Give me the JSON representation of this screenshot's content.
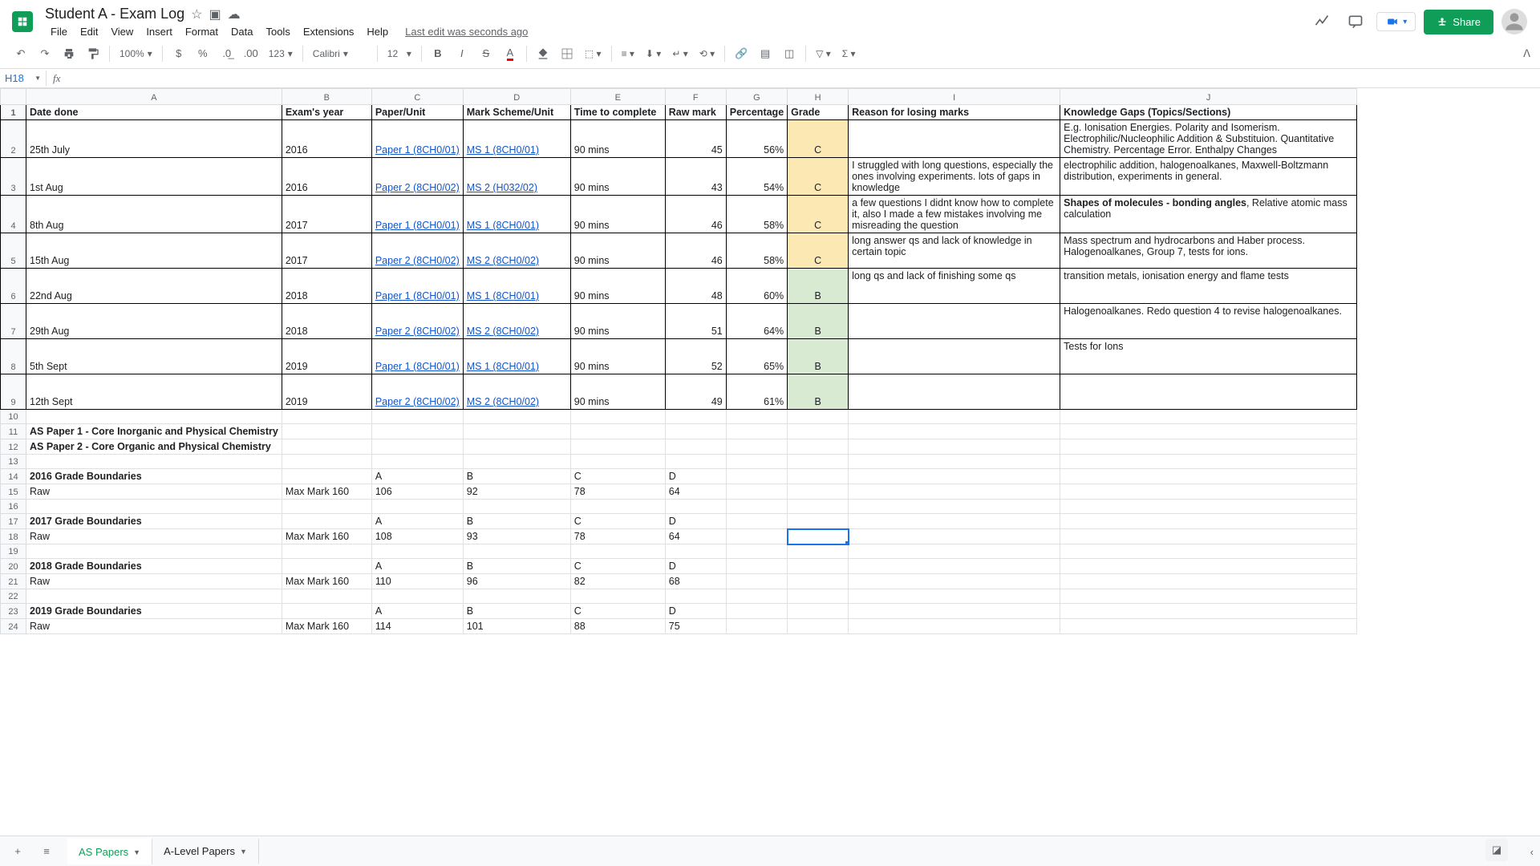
{
  "header": {
    "doc_title": "Student A - Exam Log",
    "menus": [
      "File",
      "Edit",
      "View",
      "Insert",
      "Format",
      "Data",
      "Tools",
      "Extensions",
      "Help"
    ],
    "last_edit": "Last edit was seconds ago",
    "share_label": "Share"
  },
  "toolbar": {
    "zoom": "100%",
    "dec_format": "123",
    "font": "Calibri",
    "size": "12"
  },
  "namebox": {
    "cell": "H18"
  },
  "columns": [
    "A",
    "B",
    "C",
    "D",
    "E",
    "F",
    "G",
    "H",
    "I",
    "J"
  ],
  "headers": [
    "Date done",
    "Exam's year",
    "Paper/Unit",
    "Mark Scheme/Unit",
    "Time to complete",
    "Raw mark",
    "Percentage",
    "Grade",
    "Reason for losing marks",
    "Knowledge Gaps (Topics/Sections)"
  ],
  "rows": [
    {
      "date": "25th July",
      "year": "2016",
      "paper": "Paper 1 (8CH0/01)",
      "ms": "MS 1 (8CH0/01)",
      "time": "90 mins",
      "raw": "45",
      "pct": "56%",
      "grade": "C",
      "gc": "grade-c",
      "reason": "",
      "gaps": "E.g. Ionisation Energies. Polarity and Isomerism. Electrophilic/Nucleophilic Addition & Substituion. Quantitative Chemistry. Percentage Error. Enthalpy Changes"
    },
    {
      "date": "1st Aug",
      "year": "2016",
      "paper": "Paper 2 (8CH0/02)",
      "ms": "MS 2 (H032/02)",
      "time": "90 mins",
      "raw": "43",
      "pct": "54%",
      "grade": "C",
      "gc": "grade-c",
      "reason": "I struggled with long questions, especially the ones involving experiments. lots of gaps in knowledge",
      "gaps": "electrophilic addition, halogenoalkanes, Maxwell-Boltzmann distribution, experiments in general."
    },
    {
      "date": "8th Aug",
      "year": "2017",
      "paper": "Paper 1 (8CH0/01)",
      "ms": "MS 1 (8CH0/01)",
      "time": "90 mins",
      "raw": "46",
      "pct": "58%",
      "grade": "C",
      "gc": "grade-c",
      "reason": "a few questions I didnt know how to complete it, also I made a few mistakes involving me misreading the question",
      "gaps_bold": "Shapes of molecules - bonding angles",
      "gaps_rest": ", Relative atomic mass calculation"
    },
    {
      "date": "15th Aug",
      "year": "2017",
      "paper": "Paper 2 (8CH0/02)",
      "ms": "MS 2 (8CH0/02)",
      "time": "90 mins",
      "raw": "46",
      "pct": "58%",
      "grade": "C",
      "gc": "grade-c",
      "reason": "long answer qs and lack of knowledge in certain topic",
      "gaps": "Mass spectrum and hydrocarbons and Haber process. Halogenoalkanes, Group 7, tests for ions."
    },
    {
      "date": "22nd Aug",
      "year": "2018",
      "paper": "Paper 1 (8CH0/01)",
      "ms": "MS 1 (8CH0/01)",
      "time": "90 mins",
      "raw": "48",
      "pct": "60%",
      "grade": "B",
      "gc": "grade-b",
      "reason": "long qs and lack of finishing some qs",
      "gaps": "transition metals, ionisation energy and flame tests"
    },
    {
      "date": "29th Aug",
      "year": "2018",
      "paper": "Paper 2 (8CH0/02)",
      "ms": "MS 2 (8CH0/02)",
      "time": "90 mins",
      "raw": "51",
      "pct": "64%",
      "grade": "B",
      "gc": "grade-b",
      "reason": "",
      "gaps": "Halogenoalkanes. Redo question 4 to revise halogenoalkanes."
    },
    {
      "date": "5th Sept",
      "year": "2019",
      "paper": "Paper 1 (8CH0/01)",
      "ms": "MS 1 (8CH0/01)",
      "time": "90 mins",
      "raw": "52",
      "pct": "65%",
      "grade": "B",
      "gc": "grade-b",
      "reason": "",
      "gaps": "Tests for Ions"
    },
    {
      "date": "12th Sept",
      "year": "2019",
      "paper": "Paper 2 (8CH0/02)",
      "ms": "MS 2 (8CH0/02)",
      "time": "90 mins",
      "raw": "49",
      "pct": "61%",
      "grade": "B",
      "gc": "grade-b",
      "reason": "",
      "gaps": ""
    }
  ],
  "boundaries": {
    "as1": "AS Paper 1 - Core Inorganic and Physical Chemistry",
    "as2": "AS Paper 2 - Core Organic and Physical Chemistry",
    "t2016": "2016 Grade Boundaries",
    "t2017": "2017 Grade Boundaries",
    "t2018": "2018 Grade Boundaries",
    "t2019": "2019 Grade Boundaries",
    "raw": "Raw",
    "max": "Max Mark 160",
    "l": {
      "a": "A",
      "b": "B",
      "c": "C",
      "d": "D"
    },
    "y2016": {
      "a": "106",
      "b": "92",
      "c": "78",
      "d": "64"
    },
    "y2017": {
      "a": "108",
      "b": "93",
      "c": "78",
      "d": "64"
    },
    "y2018": {
      "a": "110",
      "b": "96",
      "c": "82",
      "d": "68"
    },
    "y2019": {
      "a": "114",
      "b": "101",
      "c": "88",
      "d": "75"
    }
  },
  "tabs": {
    "active": "AS Papers",
    "other": "A-Level Papers"
  }
}
